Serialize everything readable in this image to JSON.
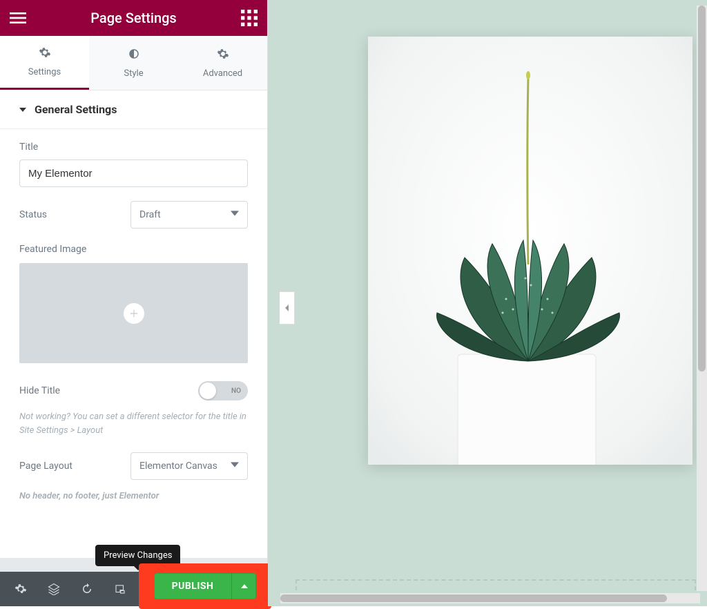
{
  "header": {
    "title": "Page Settings"
  },
  "tabs": {
    "settings": "Settings",
    "style": "Style",
    "advanced": "Advanced"
  },
  "section": {
    "heading": "General Settings",
    "title_label": "Title",
    "title_value": "My Elementor",
    "status_label": "Status",
    "status_value": "Draft",
    "featured_label": "Featured Image",
    "hide_title_label": "Hide Title",
    "hide_title_toggle": "NO",
    "hide_title_help": "Not working? You can set a different selector for the title in Site Settings > Layout",
    "page_layout_label": "Page Layout",
    "page_layout_value": "Elementor Canvas",
    "page_layout_help": "No header, no footer, just Elementor"
  },
  "tooltip": {
    "preview": "Preview Changes"
  },
  "footer": {
    "publish": "PUBLISH"
  }
}
